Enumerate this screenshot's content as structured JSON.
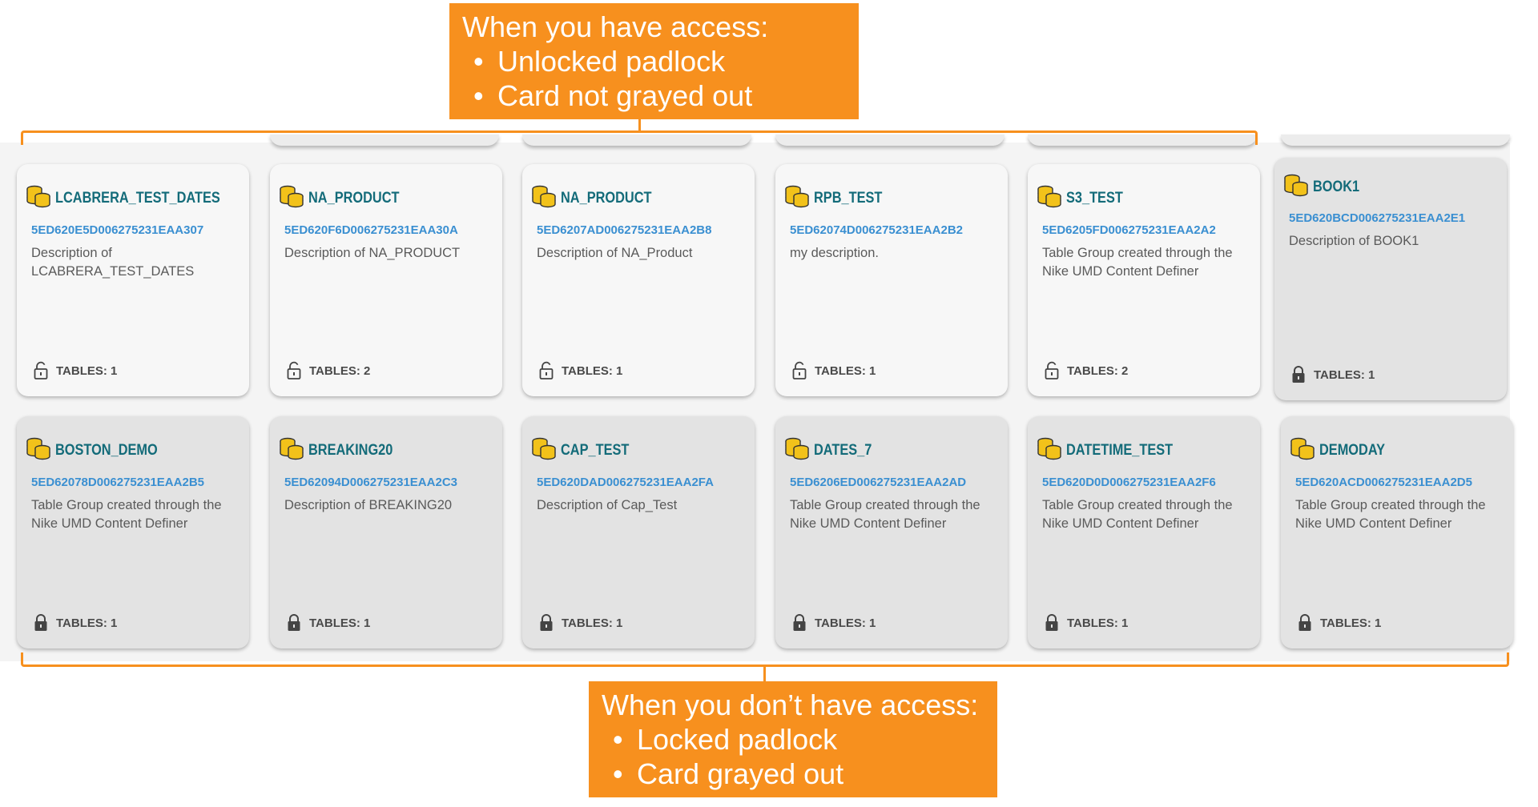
{
  "callouts": {
    "top": {
      "title": "When you have access:",
      "bullets": [
        "Unlocked padlock",
        "Card not grayed out"
      ]
    },
    "bottom": {
      "title": "When you don’t have access:",
      "bullets": [
        "Locked padlock",
        "Card grayed out"
      ]
    },
    "accent": "#f7901e"
  },
  "colors": {
    "name": "#136b79",
    "id": "#3a8fd1",
    "card_open": "#f7f7f7",
    "card_locked": "#e3e3e3"
  },
  "cards": [
    {
      "name": "LCABRERA_TEST_DATES",
      "id": "5ED620E5D006275231EAA307",
      "description": "Description of LCABRERA_TEST_DATES",
      "tables": "TABLES: 1",
      "locked": false,
      "icon": "database-stack-icon"
    },
    {
      "name": "NA_PRODUCT",
      "id": "5ED620F6D006275231EAA30A",
      "description": "Description of NA_PRODUCT",
      "tables": "TABLES: 2",
      "locked": false,
      "icon": "database-stack-icon"
    },
    {
      "name": "NA_PRODUCT",
      "id": "5ED6207AD006275231EAA2B8",
      "description": "Description of NA_Product",
      "tables": "TABLES: 1",
      "locked": false,
      "icon": "database-stack-icon"
    },
    {
      "name": "RPB_TEST",
      "id": "5ED62074D006275231EAA2B2",
      "description": "my description.",
      "tables": "TABLES: 1",
      "locked": false,
      "icon": "database-stack-icon"
    },
    {
      "name": "S3_TEST",
      "id": "5ED6205FD006275231EAA2A2",
      "description": "Table Group created through the Nike UMD Content Definer",
      "tables": "TABLES: 2",
      "locked": false,
      "icon": "database-stack-icon"
    },
    {
      "name": "BOOK1",
      "id": "5ED620BCD006275231EAA2E1",
      "description": "Description of BOOK1",
      "tables": "TABLES: 1",
      "locked": true,
      "icon": "database-stack-icon"
    },
    {
      "name": "BOSTON_DEMO",
      "id": "5ED62078D006275231EAA2B5",
      "description": "Table Group created through the Nike UMD Content Definer",
      "tables": "TABLES: 1",
      "locked": true,
      "icon": "database-stack-icon"
    },
    {
      "name": "BREAKING20",
      "id": "5ED62094D006275231EAA2C3",
      "description": "Description of BREAKING20",
      "tables": "TABLES: 1",
      "locked": true,
      "icon": "database-stack-icon"
    },
    {
      "name": "CAP_TEST",
      "id": "5ED620DAD006275231EAA2FA",
      "description": "Description of Cap_Test",
      "tables": "TABLES: 1",
      "locked": true,
      "icon": "database-stack-icon"
    },
    {
      "name": "DATES_7",
      "id": "5ED6206ED006275231EAA2AD",
      "description": "Table Group created through the Nike UMD Content Definer",
      "tables": "TABLES: 1",
      "locked": true,
      "icon": "database-stack-icon"
    },
    {
      "name": "DATETIME_TEST",
      "id": "5ED620D0D006275231EAA2F6",
      "description": "Table Group created through the Nike UMD Content Definer",
      "tables": "TABLES: 1",
      "locked": true,
      "icon": "database-stack-icon"
    },
    {
      "name": "DEMODAY",
      "id": "5ED620ACD006275231EAA2D5",
      "description": "Table Group created through the Nike UMD Content Definer",
      "tables": "TABLES: 1",
      "locked": true,
      "icon": "database-stack-icon"
    }
  ]
}
